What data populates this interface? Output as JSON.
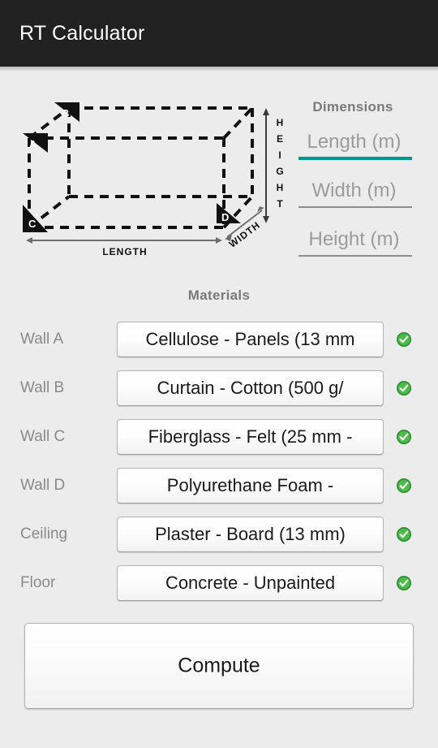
{
  "app": {
    "title": "RT Calculator",
    "titlebar_color": "#212121",
    "background_color": "#ececec",
    "accent_color": "#009688",
    "check_color": "#3aa93a"
  },
  "diagram": {
    "name": "room-box-diagram",
    "corner_labels": [
      "A",
      "B",
      "C",
      "D"
    ],
    "dimension_labels": {
      "length": "LENGTH",
      "width": "WIDTH",
      "height": "HEIGHT"
    }
  },
  "dimensions": {
    "heading": "Dimensions",
    "fields": [
      {
        "name": "length-input",
        "placeholder": "Length (m)",
        "value": "",
        "focused": true
      },
      {
        "name": "width-input",
        "placeholder": "Width (m)",
        "value": "",
        "focused": false
      },
      {
        "name": "height-input",
        "placeholder": "Height (m)",
        "value": "",
        "focused": false
      }
    ]
  },
  "materials": {
    "heading": "Materials",
    "rows": [
      {
        "label": "Wall A",
        "value": "Cellulose - Panels (13 mm",
        "status": "valid"
      },
      {
        "label": "Wall B",
        "value": "Curtain - Cotton (500 g/",
        "status": "valid"
      },
      {
        "label": "Wall C",
        "value": "Fiberglass - Felt (25 mm -",
        "status": "valid"
      },
      {
        "label": "Wall D",
        "value": "Polyurethane Foam -",
        "status": "valid"
      },
      {
        "label": "Ceiling",
        "value": "Plaster - Board (13 mm)",
        "status": "valid"
      },
      {
        "label": "Floor",
        "value": "Concrete - Unpainted",
        "status": "valid"
      }
    ]
  },
  "actions": {
    "compute_label": "Compute"
  }
}
